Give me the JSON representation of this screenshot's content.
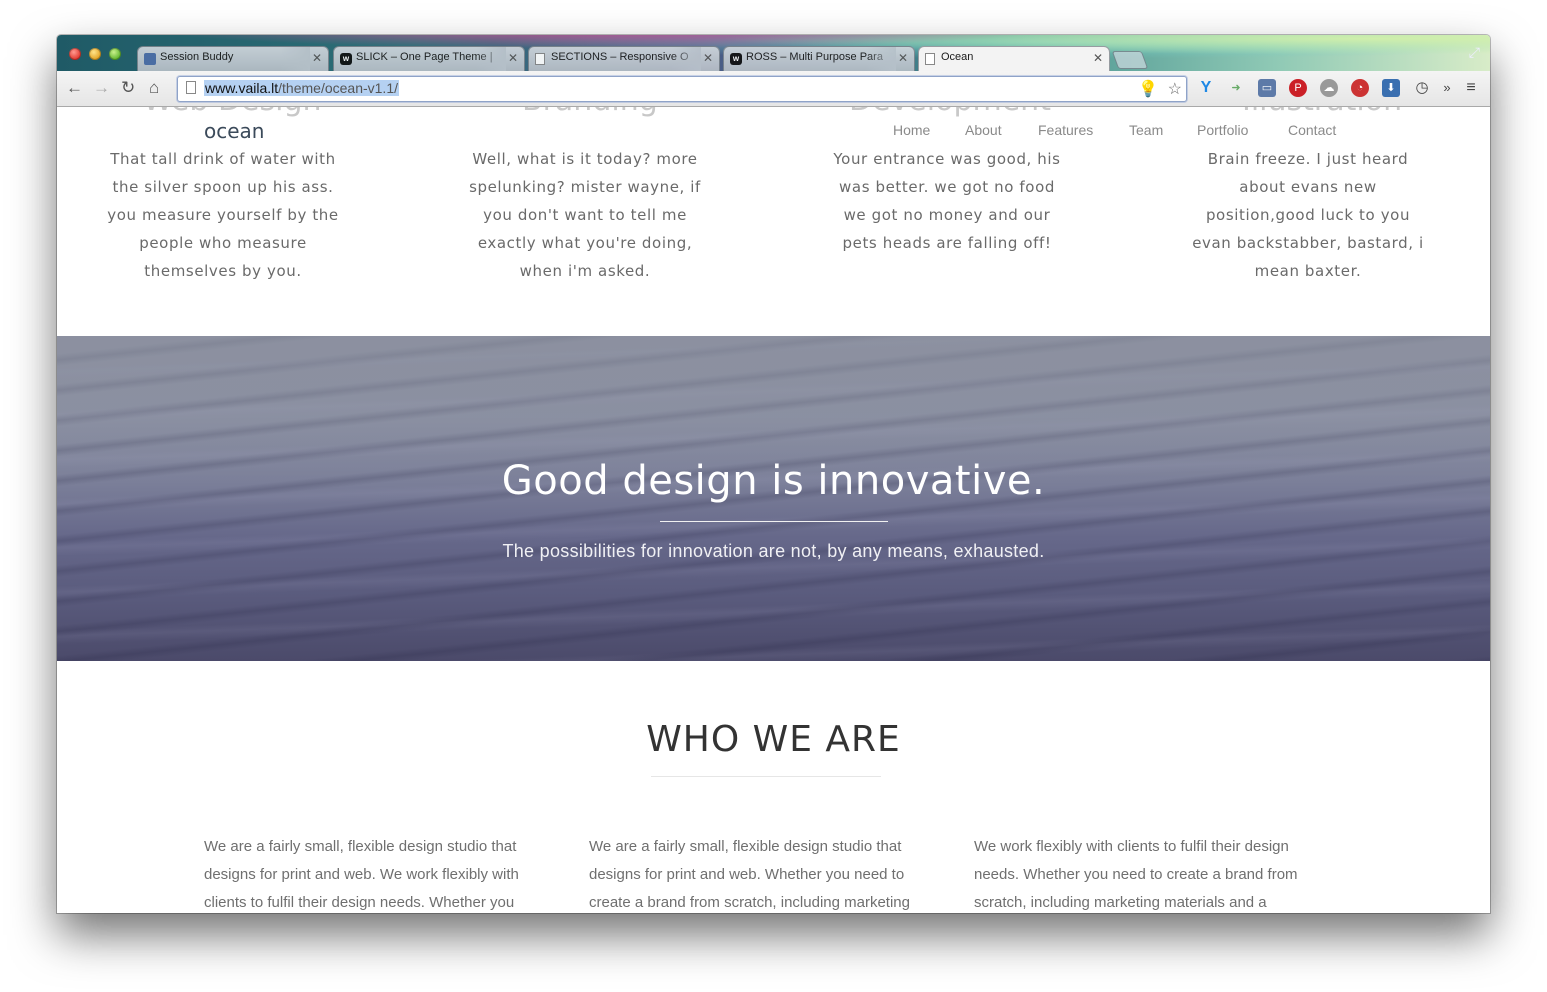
{
  "browser": {
    "tabs": [
      {
        "title": "Session Buddy",
        "favicon": "session-buddy-icon"
      },
      {
        "title": "SLICK – One Page Theme | ",
        "favicon": "w-icon"
      },
      {
        "title": "SECTIONS – Responsive O",
        "favicon": "page-icon"
      },
      {
        "title": "ROSS – Multi Purpose Para",
        "favicon": "w-icon"
      },
      {
        "title": "Ocean",
        "favicon": "page-icon",
        "active": true
      }
    ],
    "url_host": "www.vaila.lt",
    "url_path": "/theme/ocean-v1.1/"
  },
  "site": {
    "brand": "ocean",
    "nav": [
      "Home",
      "About",
      "Features",
      "Team",
      "Portfolio",
      "Contact"
    ]
  },
  "services": [
    {
      "heading": "Web Design",
      "text": "That tall drink of water with the silver spoon up his ass. you measure yourself by the people who measure themselves by you."
    },
    {
      "heading": "Branding",
      "text": "Well, what is it today? more spelunking? mister wayne, if you don't want to tell me exactly what you're doing, when i'm asked."
    },
    {
      "heading": "Development",
      "text": "Your entrance was good, his was better. we got no food we got no money and our pets heads are falling off!"
    },
    {
      "heading": "Illustration",
      "text": "Brain freeze. I just heard about evans new position,good luck to you evan backstabber, bastard, i mean baxter."
    }
  ],
  "hero": {
    "title": "Good design is innovative.",
    "subtitle": "The possibilities for innovation are not, by any means, exhausted."
  },
  "about": {
    "title": "WHO WE ARE",
    "columns": [
      "We are a fairly small, flexible design studio that designs for print and web. We work flexibly with clients to fulfil their design needs. Whether you",
      "We are a fairly small, flexible design studio that designs for print and web. Whether you need to create a brand from scratch, including marketing",
      "We work flexibly with clients to fulfil their design needs. Whether you need to create a brand from scratch, including marketing materials and a"
    ]
  }
}
